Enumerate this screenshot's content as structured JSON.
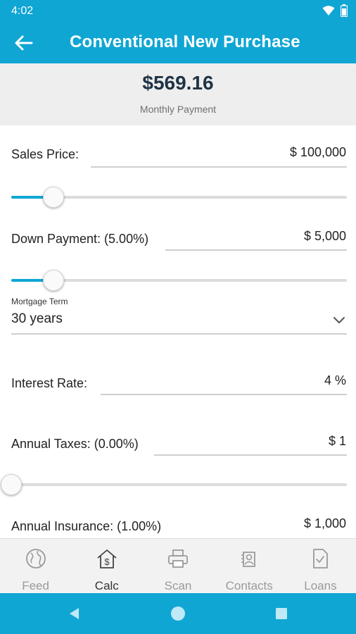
{
  "status_bar": {
    "time": "4:02"
  },
  "app_bar": {
    "title": "Conventional New Purchase"
  },
  "summary": {
    "payment": "$569.16",
    "payment_label": "Monthly Payment"
  },
  "form": {
    "sales_price": {
      "label": "Sales Price:",
      "value": "$ 100,000",
      "slider_fraction": 0.1
    },
    "down_payment": {
      "label": "Down Payment: (5.00%)",
      "value": "$ 5,000",
      "slider_fraction": 0.1
    },
    "mortgage_term": {
      "caption": "Mortgage Term",
      "value": "30 years"
    },
    "interest_rate": {
      "label": "Interest Rate:",
      "value": "4 %"
    },
    "annual_taxes": {
      "label": "Annual Taxes: (0.00%)",
      "value": "$ 1",
      "slider_fraction": 0.0
    },
    "annual_insurance": {
      "label": "Annual Insurance: (1.00%)",
      "value": "$ 1,000"
    }
  },
  "bottom_nav": [
    {
      "label": "Feed",
      "icon": "globe-icon",
      "active": false
    },
    {
      "label": "Calc",
      "icon": "house-dollar-icon",
      "active": true
    },
    {
      "label": "Scan",
      "icon": "printer-icon",
      "active": false
    },
    {
      "label": "Contacts",
      "icon": "contacts-icon",
      "active": false
    },
    {
      "label": "Loans",
      "icon": "document-check-icon",
      "active": false
    }
  ],
  "colors": {
    "accent": "#0fa6d4",
    "panel": "#eeeeee",
    "text_dark": "#1f3345"
  }
}
